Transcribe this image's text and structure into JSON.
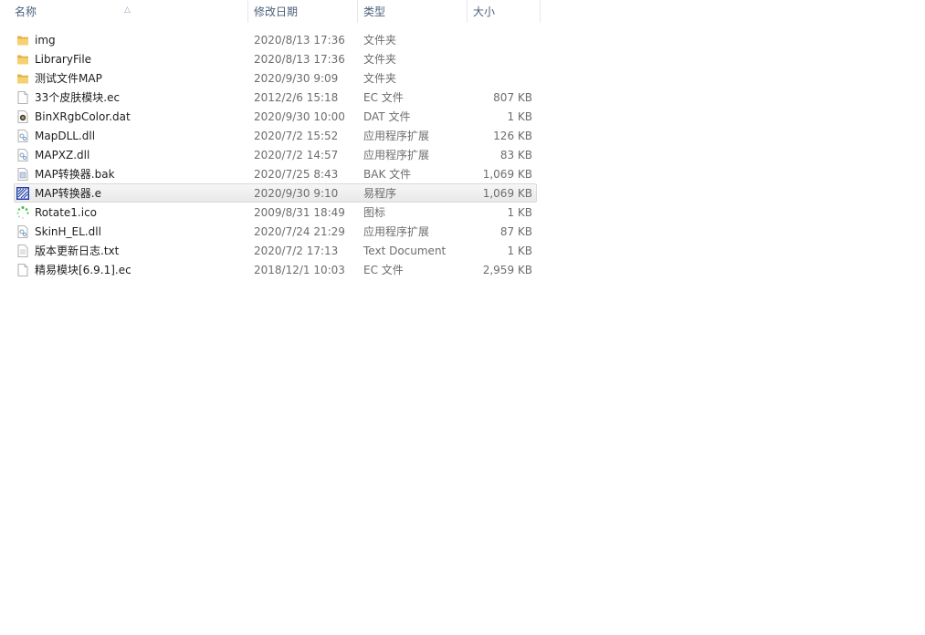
{
  "columns": {
    "name": "名称",
    "date": "修改日期",
    "type": "类型",
    "size": "大小"
  },
  "files": [
    {
      "name": "img",
      "date": "2020/8/13 17:36",
      "type": "文件夹",
      "size": "",
      "icon": "folder-icon"
    },
    {
      "name": "LibraryFile",
      "date": "2020/8/13 17:36",
      "type": "文件夹",
      "size": "",
      "icon": "folder-icon"
    },
    {
      "name": "测试文件MAP",
      "date": "2020/9/30 9:09",
      "type": "文件夹",
      "size": "",
      "icon": "folder-icon"
    },
    {
      "name": "33个皮肤模块.ec",
      "date": "2012/2/6 15:18",
      "type": "EC 文件",
      "size": "807 KB",
      "icon": "file-icon"
    },
    {
      "name": "BinXRgbColor.dat",
      "date": "2020/9/30 10:00",
      "type": "DAT 文件",
      "size": "1 KB",
      "icon": "dat-file-icon"
    },
    {
      "name": "MapDLL.dll",
      "date": "2020/7/2 15:52",
      "type": "应用程序扩展",
      "size": "126 KB",
      "icon": "dll-file-icon"
    },
    {
      "name": "MAPXZ.dll",
      "date": "2020/7/2 14:57",
      "type": "应用程序扩展",
      "size": "83 KB",
      "icon": "dll-file-icon"
    },
    {
      "name": "MAP转换器.bak",
      "date": "2020/7/25 8:43",
      "type": "BAK 文件",
      "size": "1,069 KB",
      "icon": "bak-file-icon"
    },
    {
      "name": "MAP转换器.e",
      "date": "2020/9/30 9:10",
      "type": "易程序",
      "size": "1,069 KB",
      "icon": "e-program-icon",
      "selected": true
    },
    {
      "name": "Rotate1.ico",
      "date": "2009/8/31 18:49",
      "type": "图标",
      "size": "1 KB",
      "icon": "ico-file-icon"
    },
    {
      "name": "SkinH_EL.dll",
      "date": "2020/7/24 21:29",
      "type": "应用程序扩展",
      "size": "87 KB",
      "icon": "dll-file-icon"
    },
    {
      "name": "版本更新日志.txt",
      "date": "2020/7/2 17:13",
      "type": "Text Document",
      "size": "1 KB",
      "icon": "text-file-icon"
    },
    {
      "name": "精易模块[6.9.1].ec",
      "date": "2018/12/1 10:03",
      "type": "EC 文件",
      "size": "2,959 KB",
      "icon": "file-icon"
    }
  ],
  "colors": {
    "header_text": "#4c607a",
    "folder": "#f2c45a",
    "e_program": "#1f3fa8"
  }
}
